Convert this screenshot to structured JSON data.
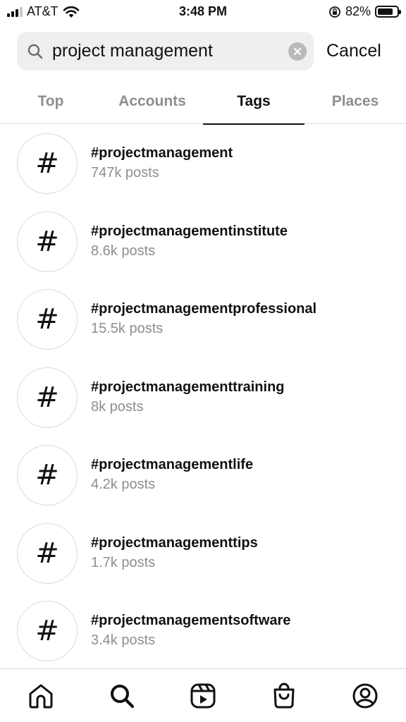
{
  "status_bar": {
    "carrier": "AT&T",
    "time": "3:48 PM",
    "battery_percent": "82%",
    "battery_level": 0.82
  },
  "search": {
    "query": "project management",
    "cancel_label": "Cancel"
  },
  "tabs": [
    {
      "label": "Top",
      "active": false
    },
    {
      "label": "Accounts",
      "active": false
    },
    {
      "label": "Tags",
      "active": true
    },
    {
      "label": "Places",
      "active": false
    }
  ],
  "results": [
    {
      "symbol": "#",
      "name": "#projectmanagement",
      "posts": "747k posts"
    },
    {
      "symbol": "#",
      "name": "#projectmanagementinstitute",
      "posts": "8.6k posts"
    },
    {
      "symbol": "#",
      "name": "#projectmanagementprofessional",
      "posts": "15.5k posts"
    },
    {
      "symbol": "#",
      "name": "#projectmanagementtraining",
      "posts": "8k posts"
    },
    {
      "symbol": "#",
      "name": "#projectmanagementlife",
      "posts": "4.2k posts"
    },
    {
      "symbol": "#",
      "name": "#projectmanagementtips",
      "posts": "1.7k posts"
    },
    {
      "symbol": "#",
      "name": "#projectmanagementsoftware",
      "posts": "3.4k posts"
    }
  ],
  "bottom_nav": [
    {
      "icon": "home-icon"
    },
    {
      "icon": "search-icon"
    },
    {
      "icon": "reels-icon"
    },
    {
      "icon": "shop-icon"
    },
    {
      "icon": "profile-icon"
    }
  ]
}
